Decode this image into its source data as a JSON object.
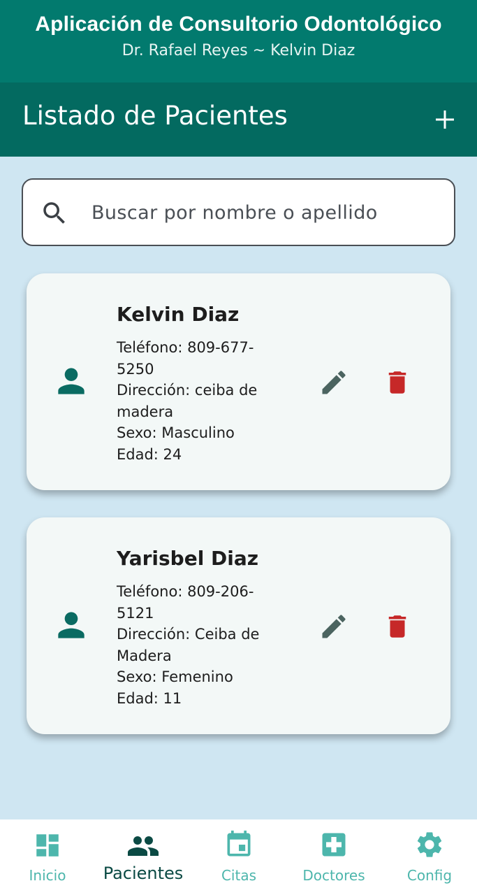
{
  "header": {
    "title": "Aplicación de Consultorio Odontológico",
    "subtitle": "Dr. Rafael Reyes ~ Kelvin Diaz"
  },
  "toolbar": {
    "title": "Listado de Pacientes",
    "add_icon": "plus-icon"
  },
  "search": {
    "placeholder": "Buscar por nombre o apellido",
    "value": "",
    "icon": "search-icon"
  },
  "patients": [
    {
      "name": "Kelvin Diaz",
      "phone": "Teléfono: 809-677-5250",
      "address": "Dirección: ceiba de madera",
      "sex": "Sexo: Masculino",
      "age": "Edad: 24"
    },
    {
      "name": "Yarisbel Diaz",
      "phone": "Teléfono: 809-206-5121",
      "address": "Dirección: Ceiba de Madera",
      "sex": "Sexo: Femenino",
      "age": "Edad: 11"
    }
  ],
  "nav": {
    "items": [
      {
        "label": "Inicio",
        "icon": "dashboard-icon"
      },
      {
        "label": "Pacientes",
        "icon": "people-icon"
      },
      {
        "label": "Citas",
        "icon": "calendar-icon"
      },
      {
        "label": "Doctores",
        "icon": "medical-cross-icon"
      },
      {
        "label": "Config",
        "icon": "gear-icon"
      }
    ],
    "active": "Pacientes"
  },
  "colors": {
    "header": "#027a6e",
    "toolbar": "#036a60",
    "background": "#cfe6f2",
    "card": "#f3f8f7",
    "delete": "#c62828",
    "edit": "#4b6460",
    "nav_inactive": "#4db6ac",
    "nav_active": "#0b4a44"
  }
}
